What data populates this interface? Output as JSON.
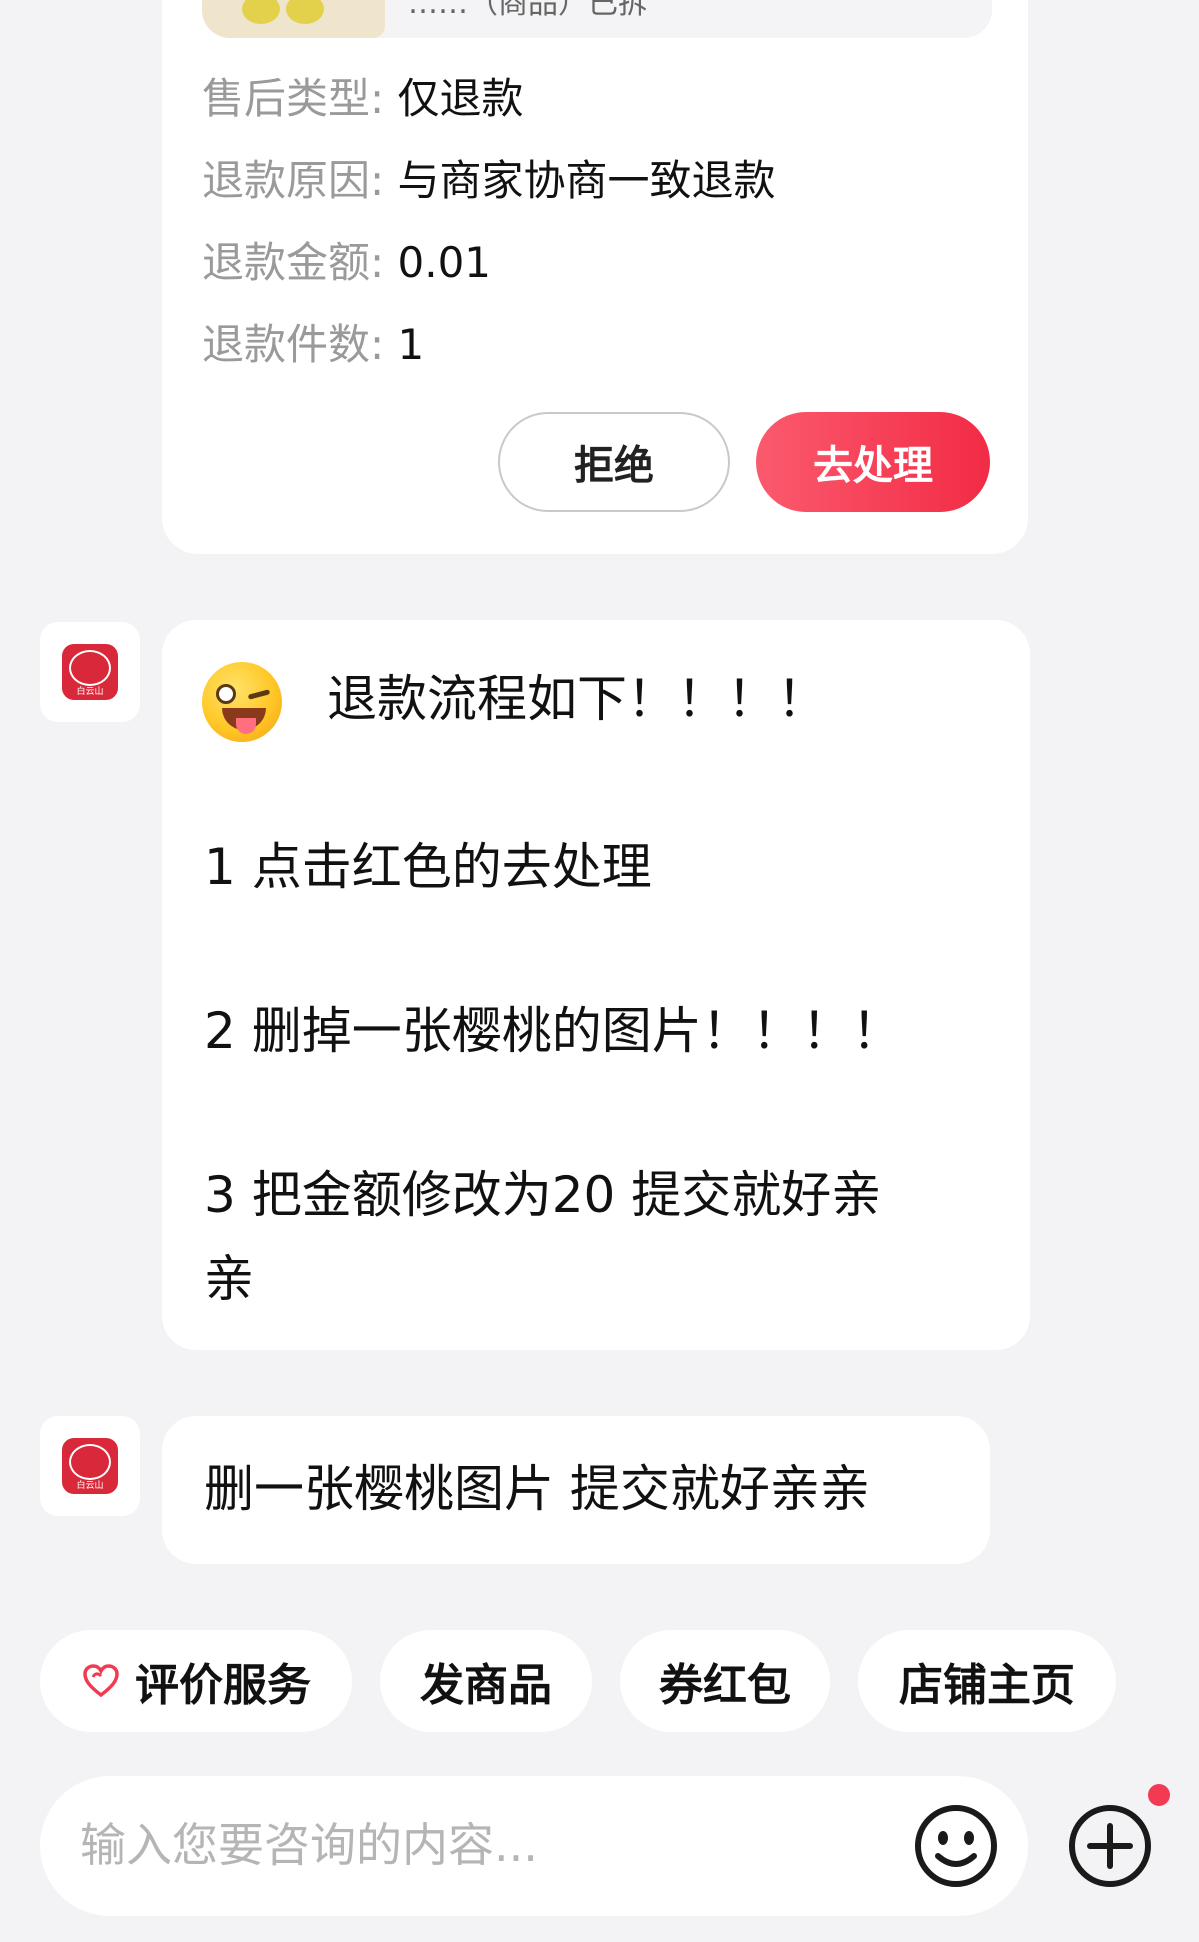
{
  "refund_card": {
    "product_title": "……（商品）已拆",
    "rows": [
      {
        "label": "售后类型:",
        "value": "仅退款"
      },
      {
        "label": "退款原因:",
        "value": "与商家协商一致退款"
      },
      {
        "label": "退款金额:",
        "value": "0.01"
      },
      {
        "label": "退款件数:",
        "value": "1"
      }
    ],
    "reject_label": "拒绝",
    "process_label": "去处理",
    "accent_color": "#f22b45"
  },
  "shop": {
    "avatar_icon": "shop-logo-icon",
    "logo_text": "白云山"
  },
  "messages": [
    {
      "emoji": "winking-tongue-face-icon",
      "title": "退款流程如下！！！！",
      "lines": [
        "1  点击红色的去处理",
        "2  删掉一张樱桃的图片！！！！",
        "3  把金额修改为20   提交就好亲",
        "亲"
      ]
    },
    {
      "text": "删一张樱桃图片    提交就好亲亲"
    }
  ],
  "quick_actions": [
    {
      "label": "评价服务",
      "icon": "heart-icon"
    },
    {
      "label": "发商品"
    },
    {
      "label": "券红包"
    },
    {
      "label": "店铺主页"
    }
  ],
  "input": {
    "placeholder": "输入您要咨询的内容...",
    "emoji_button_icon": "smiley-icon",
    "plus_button_icon": "plus-circle-icon"
  }
}
